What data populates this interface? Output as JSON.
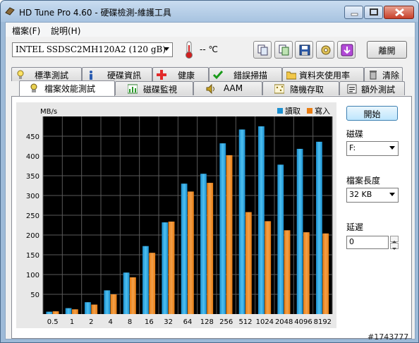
{
  "window": {
    "title": "HD Tune Pro 4.60 - 硬碟檢測-維護工具"
  },
  "menu": [
    {
      "label": "檔案(F)"
    },
    {
      "label": "說明(H)"
    }
  ],
  "toolbar": {
    "drive": "INTEL SSDSC2MH120A2 (120 gB)",
    "temperature": "-- ℃",
    "exit_label": "離開"
  },
  "tabs_row1": [
    {
      "label": "標準測試",
      "icon": "bulb-icon"
    },
    {
      "label": "硬碟資訊",
      "icon": "info-icon"
    },
    {
      "label": "健康",
      "icon": "health-cross-icon"
    },
    {
      "label": "錯誤掃描",
      "icon": "check-icon"
    },
    {
      "label": "資料夾使用率",
      "icon": "folder-icon"
    },
    {
      "label": "清除",
      "icon": "trash-icon"
    }
  ],
  "tabs_row2": [
    {
      "label": "檔案效能測試",
      "icon": "file-benchmark-icon",
      "active": true
    },
    {
      "label": "磁碟監視",
      "icon": "monitor-chart-icon"
    },
    {
      "label": "AAM",
      "icon": "speaker-icon"
    },
    {
      "label": "隨機存取",
      "icon": "random-access-icon"
    },
    {
      "label": "額外測試",
      "icon": "extra-tests-icon"
    }
  ],
  "side": {
    "start_label": "開始",
    "drive_label": "磁碟",
    "drive_value": "F:",
    "file_length_label": "檔案長度",
    "file_length_value": "32 KB",
    "delay_label": "延遲",
    "delay_value": "0"
  },
  "chart_data": {
    "type": "bar",
    "ylabel": "MB/s",
    "ylim": [
      0,
      500
    ],
    "yticks": [
      50,
      100,
      150,
      200,
      250,
      300,
      350,
      400,
      450
    ],
    "categories": [
      "0.5",
      "1",
      "2",
      "4",
      "8",
      "16",
      "32",
      "64",
      "128",
      "256",
      "512",
      "1024",
      "2048",
      "4096",
      "8192"
    ],
    "series": [
      {
        "name": "讀取",
        "color": "#1a8fd0",
        "values": [
          6,
          15,
          30,
          60,
          105,
          172,
          232,
          330,
          355,
          432,
          467,
          475,
          378,
          418,
          436
        ]
      },
      {
        "name": "寫入",
        "color": "#e87d12",
        "values": [
          7,
          12,
          24,
          50,
          93,
          155,
          234,
          310,
          332,
          402,
          258,
          235,
          212,
          207,
          204
        ]
      }
    ],
    "legend_position": "top-right",
    "grid": true
  },
  "watermark": "#1743777"
}
